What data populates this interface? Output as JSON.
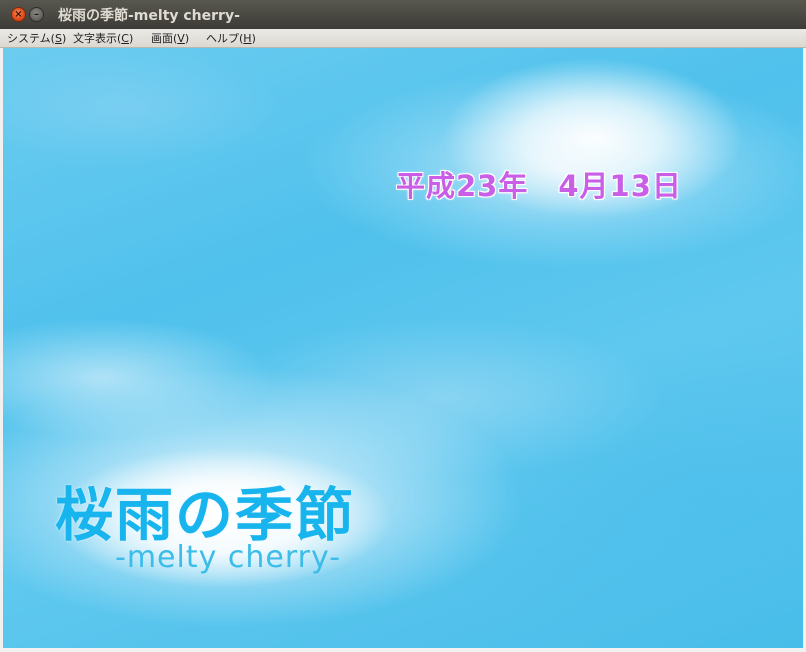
{
  "window": {
    "title": "桜雨の季節-melty cherry-",
    "close_glyph": "×",
    "minimize_glyph": "–"
  },
  "menubar": {
    "items": [
      {
        "label": "システム(",
        "key": "S",
        "suffix": ")"
      },
      {
        "label": "文字表示(",
        "key": "C",
        "suffix": ")"
      },
      {
        "label": "画面(",
        "key": "V",
        "suffix": ")"
      },
      {
        "label": "ヘルプ(",
        "key": "H",
        "suffix": ")"
      }
    ]
  },
  "game": {
    "date": "平成23年　4月13日",
    "logo_title": "桜雨の季節",
    "logo_subtitle": "-melty cherry-"
  },
  "colors": {
    "date_text": "#c85fe6",
    "logo_title": "#18b4ee",
    "logo_subtitle": "#3cbde9",
    "sky": "#4fc1ec"
  }
}
